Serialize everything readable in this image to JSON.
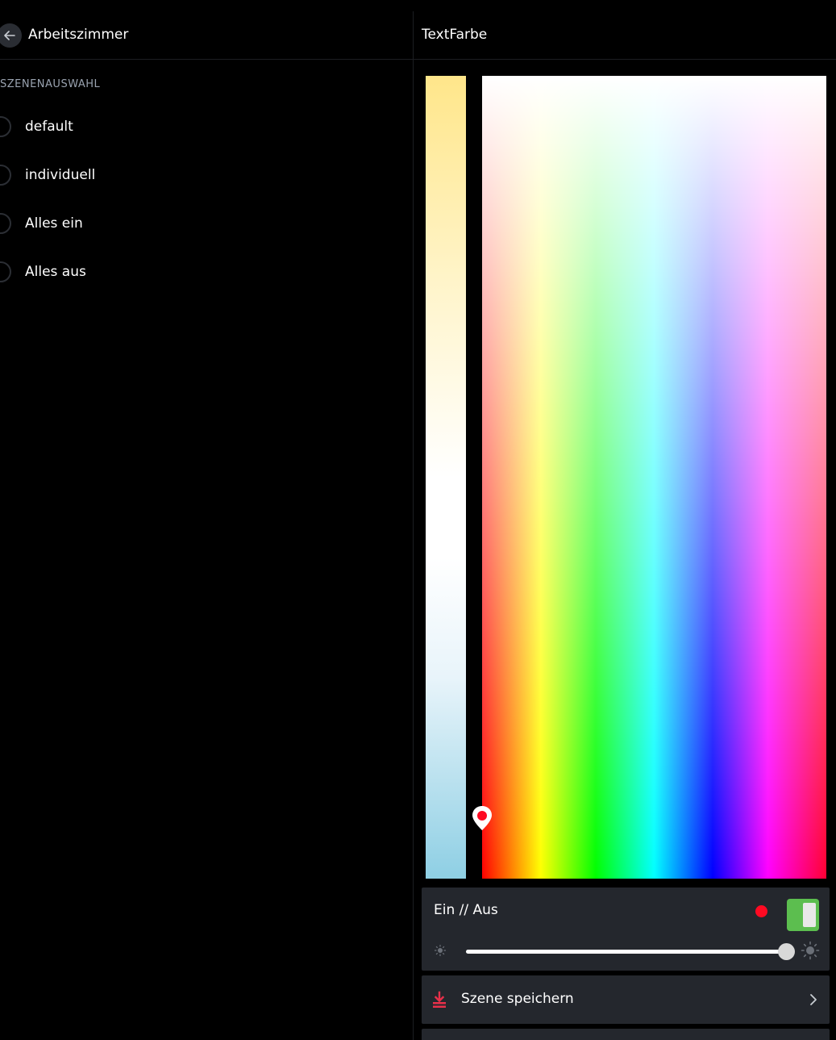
{
  "left_header": {
    "title": "Arbeitszimmer"
  },
  "scenes": {
    "section_label": "SZENENAUSWAHL",
    "items": [
      {
        "label": "default"
      },
      {
        "label": "individuell"
      },
      {
        "label": "Alles ein"
      },
      {
        "label": "Alles aus"
      }
    ]
  },
  "right_header": {
    "title": "TextFarbe"
  },
  "control": {
    "onoff_label": "Ein // Aus",
    "status_color": "#ff0a22",
    "toggle_on": true,
    "toggle_color": "#5cbe4f",
    "brightness": 1.0,
    "brightness_min_icon": "sun-small-icon",
    "brightness_max_icon": "sun-large-icon"
  },
  "save": {
    "label": "Szene speichern",
    "icon": "download-icon",
    "accent_color": "#e8304a"
  },
  "icons": {
    "back": "arrow-left-icon",
    "chevron": "chevron-right-icon",
    "picker": "map-pin-icon"
  }
}
